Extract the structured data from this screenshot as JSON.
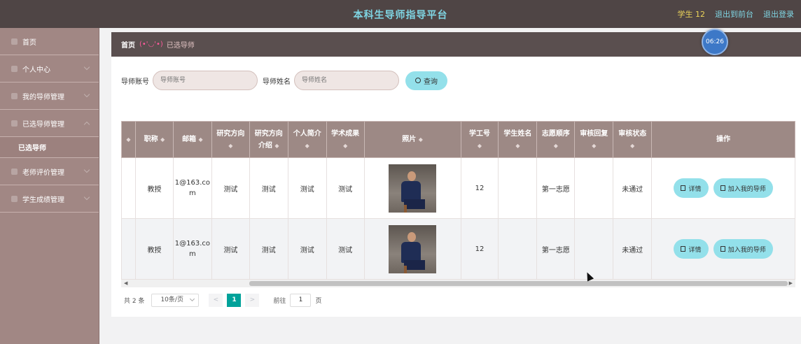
{
  "header": {
    "title": "本科生导师指导平台",
    "user": "学生 12",
    "back_link": "退出到前台",
    "logout": "退出登录"
  },
  "sidebar": {
    "items": [
      {
        "label": "首页",
        "icon": "home-icon"
      },
      {
        "label": "个人中心",
        "icon": "user-icon"
      },
      {
        "label": "我的导师管理",
        "icon": "menu-icon"
      },
      {
        "label": "已选导师管理",
        "icon": "menu-icon"
      },
      {
        "label": "老师评价管理",
        "icon": "menu-icon"
      },
      {
        "label": "学生成绩管理",
        "icon": "menu-icon"
      }
    ],
    "sub_active": "已选导师"
  },
  "breadcrumb": {
    "home": "首页",
    "face": "(•'◡'•)",
    "current": "已选导师"
  },
  "time_badge": "06:26",
  "search": {
    "account_label": "导师账号",
    "account_placeholder": "导师账号",
    "name_label": "导师姓名",
    "name_placeholder": "导师姓名",
    "query_button": "查询"
  },
  "table": {
    "headers": [
      "职称",
      "邮箱",
      "研究方向",
      "研究方向介绍",
      "个人简介",
      "学术成果",
      "照片",
      "学工号",
      "学生姓名",
      "志愿顺序",
      "审核回复",
      "审核状态",
      "操作"
    ],
    "rows": [
      {
        "title": "教授",
        "email": "1@163.com",
        "direction": "测试",
        "direction_intro": "测试",
        "intro": "测试",
        "achievement": "测试",
        "photo": "teacher-photo",
        "student_no": "12",
        "student_name": "",
        "order": "第一志愿",
        "reply": "",
        "status": "未通过",
        "detail": "详情",
        "add": "加入我的导师"
      },
      {
        "title": "教授",
        "email": "1@163.com",
        "direction": "测试",
        "direction_intro": "测试",
        "intro": "测试",
        "achievement": "测试",
        "photo": "teacher-photo",
        "student_no": "12",
        "student_name": "",
        "order": "第一志愿",
        "reply": "",
        "status": "未通过",
        "detail": "详情",
        "add": "加入我的导师"
      }
    ]
  },
  "pager": {
    "total": "共 2 条",
    "page_size": "10条/页",
    "prev": "<",
    "current": "1",
    "next": ">",
    "goto_label": "前往",
    "goto_value": "1",
    "page_unit": "页"
  },
  "colors": {
    "topbar": "#4f4545",
    "sidebar": "#a18784",
    "accent": "#93e0ea",
    "title": "#7fd5e3",
    "page_active": "#00a29a"
  }
}
